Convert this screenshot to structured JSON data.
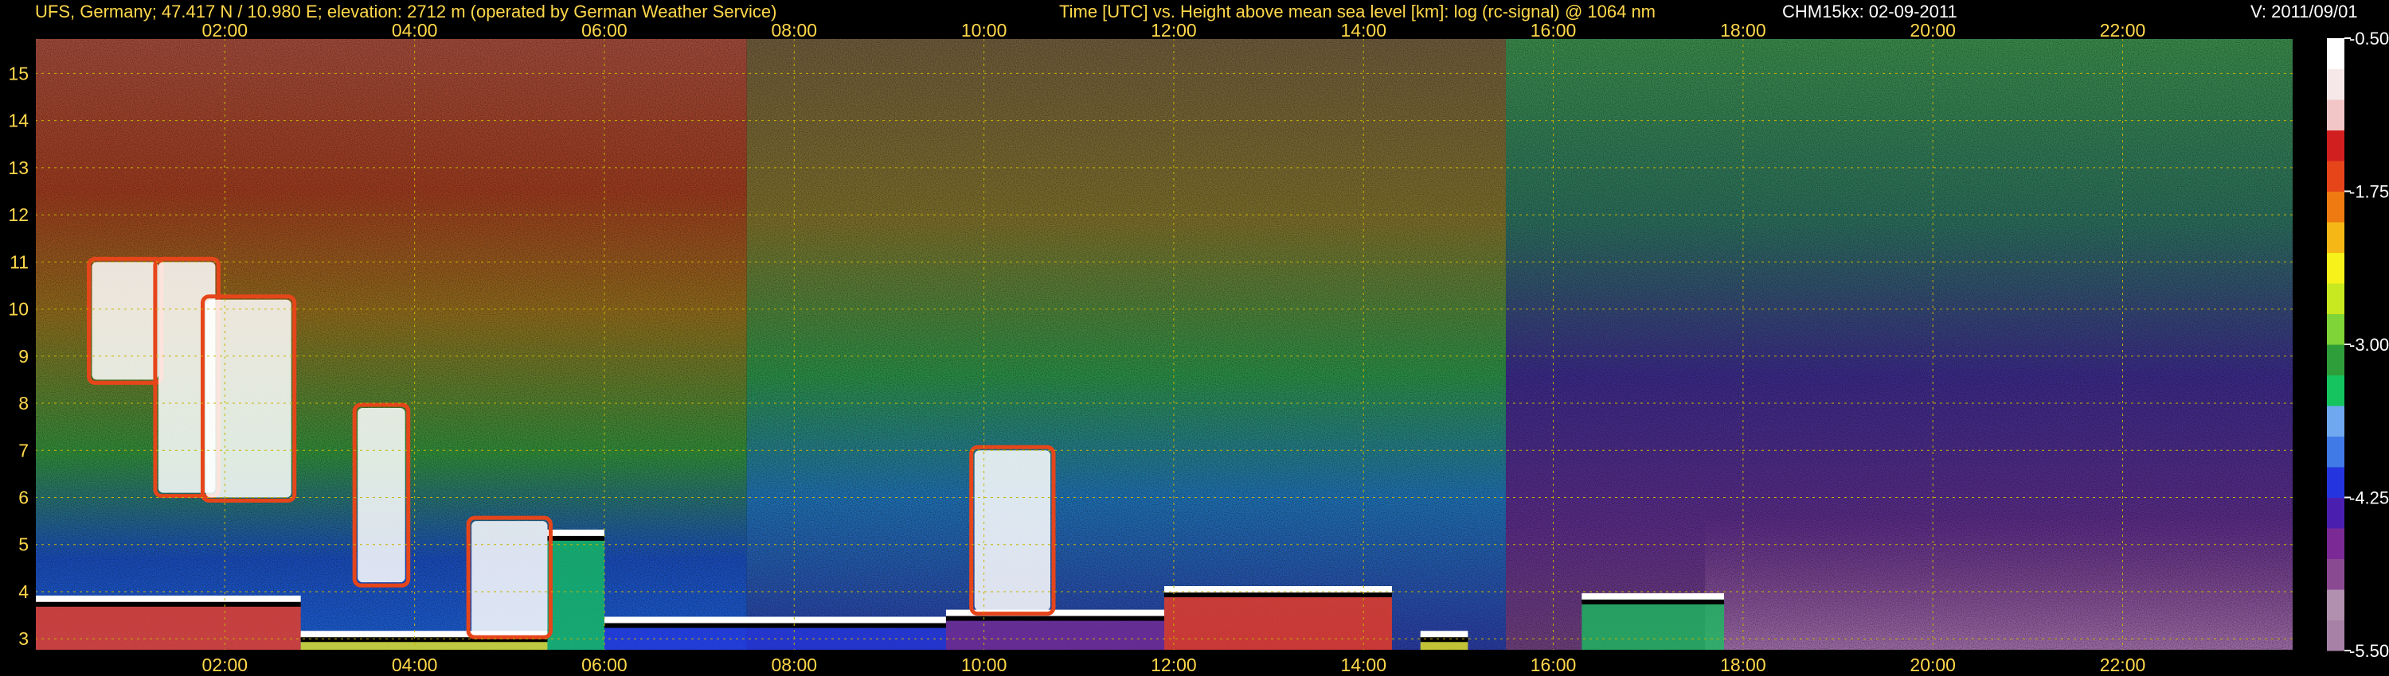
{
  "header": {
    "station": "UFS, Germany; 47.417 N / 10.980 E; elevation: 2712 m  (operated by German Weather Service)",
    "title": "Time [UTC] vs. Height above mean sea level [km]: log (rc-signal) @ 1064 nm",
    "instrument": "CHM15kx: 02-09-2011",
    "version": "V: 2011/09/01"
  },
  "colors": {
    "background": "#000000",
    "header_text": "#ffd84a",
    "tick_text": "#ffd84a",
    "grid": "#c8b400",
    "colorbar_text": "#ffffff"
  },
  "chart_data": {
    "type": "heatmap",
    "title": "Time [UTC] vs. Height above mean sea level [km]: log (rc-signal) @ 1064 nm",
    "x_ticks": [
      "02:00",
      "04:00",
      "06:00",
      "08:00",
      "10:00",
      "12:00",
      "14:00",
      "16:00",
      "18:00",
      "20:00",
      "22:00"
    ],
    "x_tick_hours": [
      2,
      4,
      6,
      8,
      10,
      12,
      14,
      16,
      18,
      20,
      22
    ],
    "xlim": [
      0.0,
      23.8
    ],
    "y_ticks": [
      3,
      4,
      5,
      6,
      7,
      8,
      9,
      10,
      11,
      12,
      13,
      14,
      15
    ],
    "ylim": [
      2.75,
      15.75
    ],
    "colorbar": {
      "ticks": [
        -0.5,
        -1.75,
        -3.0,
        -4.25,
        -5.5
      ],
      "tick_labels": [
        "-0.50",
        "-1.75",
        "-3.00",
        "-4.25",
        "-5.50"
      ],
      "range": [
        -5.5,
        -0.5
      ],
      "colors": [
        "#a882a6",
        "#b090ae",
        "#8a4a92",
        "#7b2a95",
        "#4a1fb0",
        "#2435e0",
        "#3f7ae6",
        "#70a8f0",
        "#15c45e",
        "#2e9e3b",
        "#7fd437",
        "#c8e820",
        "#f6f21a",
        "#f5b716",
        "#f07a12",
        "#e6451a",
        "#d11f1f",
        "#f2c6c6",
        "#f6e8e8",
        "#ffffff"
      ]
    },
    "grid": true,
    "cloud_base_km": [
      {
        "start": 0.0,
        "end": 2.8,
        "height": 3.85
      },
      {
        "start": 2.8,
        "end": 5.4,
        "height": 3.1
      },
      {
        "start": 5.4,
        "end": 6.0,
        "height": 5.25
      },
      {
        "start": 6.0,
        "end": 9.6,
        "height": 3.4
      },
      {
        "start": 9.6,
        "end": 11.9,
        "height": 3.55
      },
      {
        "start": 11.9,
        "end": 14.3,
        "height": 4.05
      },
      {
        "start": 14.6,
        "end": 15.1,
        "height": 3.1
      },
      {
        "start": 16.3,
        "end": 17.8,
        "height": 3.9
      }
    ]
  }
}
